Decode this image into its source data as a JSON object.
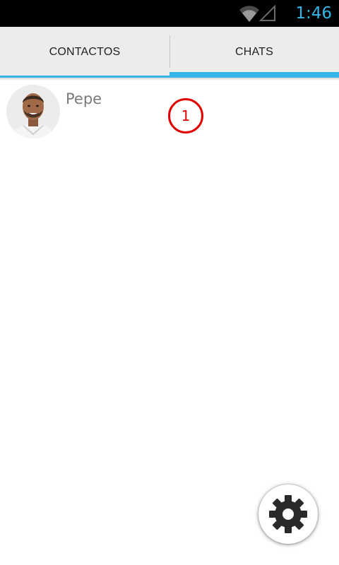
{
  "status_bar": {
    "time": "1:46",
    "icons": [
      "wifi-icon",
      "signal-icon"
    ],
    "clock_color": "#33b5e5"
  },
  "tabs": [
    {
      "label": "CONTACTOS",
      "selected": false
    },
    {
      "label": "CHATS",
      "selected": true
    }
  ],
  "accent_color": "#33b5e5",
  "chats": [
    {
      "name": "Pepe",
      "unread": "1",
      "avatar": "contact-photo"
    }
  ],
  "unread_badge_color": "#e00000",
  "fab": {
    "icon": "gear-icon"
  }
}
